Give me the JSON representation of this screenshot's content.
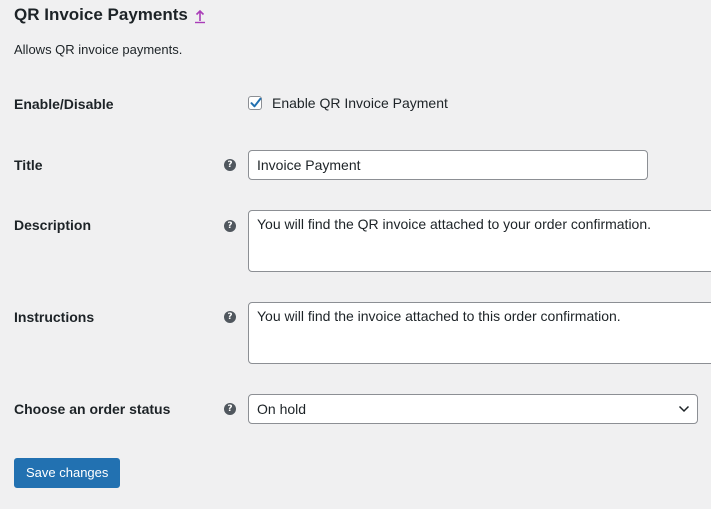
{
  "page": {
    "title": "QR Invoice Payments",
    "description": "Allows QR invoice payments."
  },
  "fields": {
    "enable": {
      "label": "Enable/Disable",
      "checkbox_label": "Enable QR Invoice Payment",
      "checked": true
    },
    "title": {
      "label": "Title",
      "value": "Invoice Payment"
    },
    "description": {
      "label": "Description",
      "value": "You will find the QR invoice attached to your order confirmation."
    },
    "instructions": {
      "label": "Instructions",
      "value": "You will find the invoice attached to this order confirmation."
    },
    "order_status": {
      "label": "Choose an order status",
      "selected": "On hold"
    }
  },
  "help_glyph": "?",
  "buttons": {
    "save_label": "Save changes"
  },
  "icons": {
    "up_link": "arrow-up-icon",
    "help": "question-circle-icon",
    "checkmark": "checkmark-icon",
    "select": "chevron-down-icon"
  },
  "colors": {
    "background": "#f0f0f1",
    "accent": "#2271b1",
    "up_link_color": "#a93db8",
    "text": "#1d2327"
  }
}
